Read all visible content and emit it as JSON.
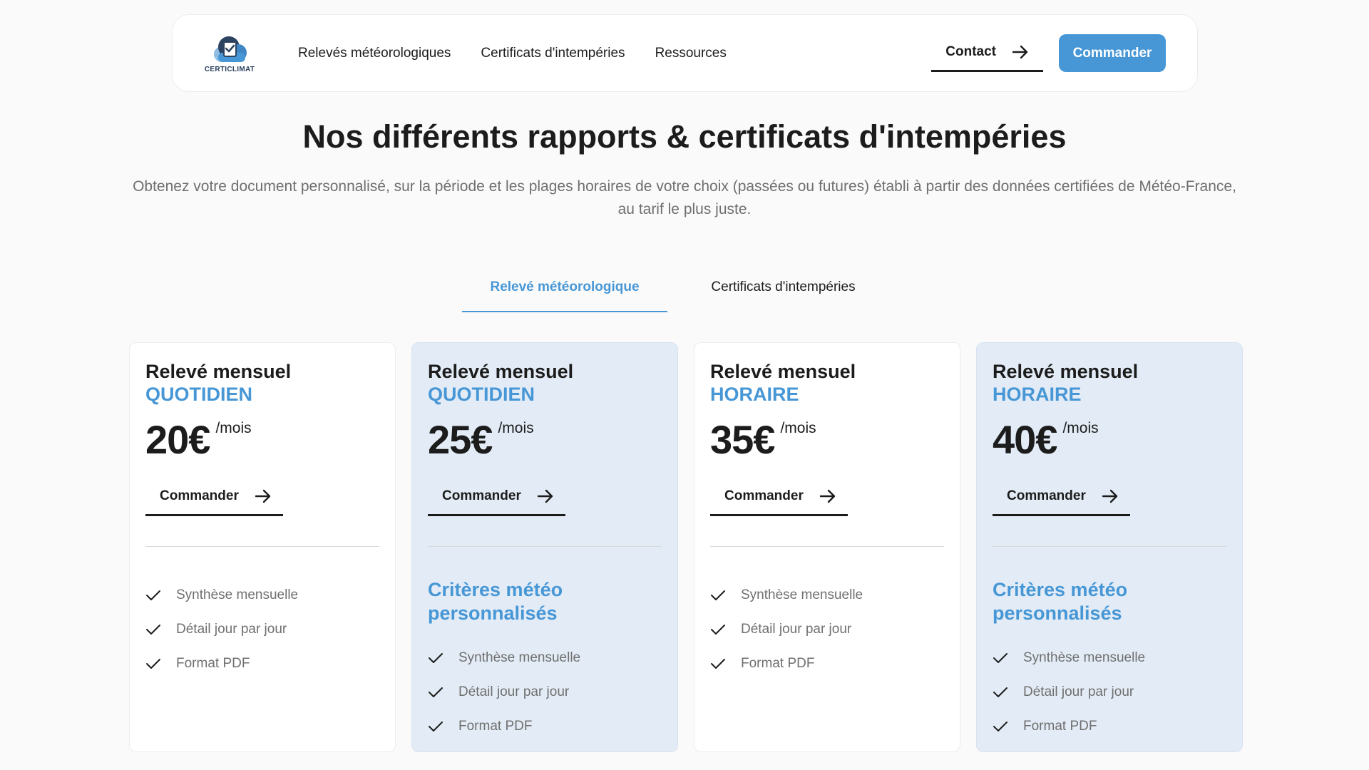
{
  "header": {
    "logo_text": "CERTICLIMAT",
    "nav": [
      "Relevés météorologiques",
      "Certificats d'intempéries",
      "Ressources"
    ],
    "contact_label": "Contact",
    "order_label": "Commander"
  },
  "hero": {
    "title": "Nos différents rapports & certificats d'intempéries",
    "subtitle": "Obtenez votre document personnalisé, sur la période et les plages horaires de votre choix (passées ou futures) établi à partir des données certifiées de Météo-France, au tarif le plus juste."
  },
  "tabs": {
    "active": "Relevé météorologique",
    "inactive": "Certificats d'intempéries"
  },
  "cards": [
    {
      "title": "Relevé mensuel",
      "type": "QUOTIDIEN",
      "price": "20€",
      "period": "/mois",
      "cta": "Commander",
      "criteria": "",
      "features": [
        "Synthèse mensuelle",
        "Détail jour par jour",
        "Format PDF"
      ]
    },
    {
      "title": "Relevé mensuel",
      "type": "QUOTIDIEN",
      "price": "25€",
      "period": "/mois",
      "cta": "Commander",
      "criteria": "Critères météo personnalisés",
      "features": [
        "Synthèse mensuelle",
        "Détail jour par jour",
        "Format PDF"
      ]
    },
    {
      "title": "Relevé mensuel",
      "type": "HORAIRE",
      "price": "35€",
      "period": "/mois",
      "cta": "Commander",
      "criteria": "",
      "features": [
        "Synthèse mensuelle",
        "Détail jour par jour",
        "Format PDF"
      ]
    },
    {
      "title": "Relevé mensuel",
      "type": "HORAIRE",
      "price": "40€",
      "period": "/mois",
      "cta": "Commander",
      "criteria": "Critères météo personnalisés",
      "features": [
        "Synthèse mensuelle",
        "Détail jour par jour",
        "Format PDF"
      ]
    }
  ],
  "icons": {
    "logo": "cloud-check-icon",
    "arrow": "arrow-right-icon",
    "check": "check-icon"
  },
  "colors": {
    "accent": "#4797d6",
    "tinted_card": "#e3ecf6",
    "text": "#1c1c1c",
    "muted": "#6f6f6f"
  }
}
